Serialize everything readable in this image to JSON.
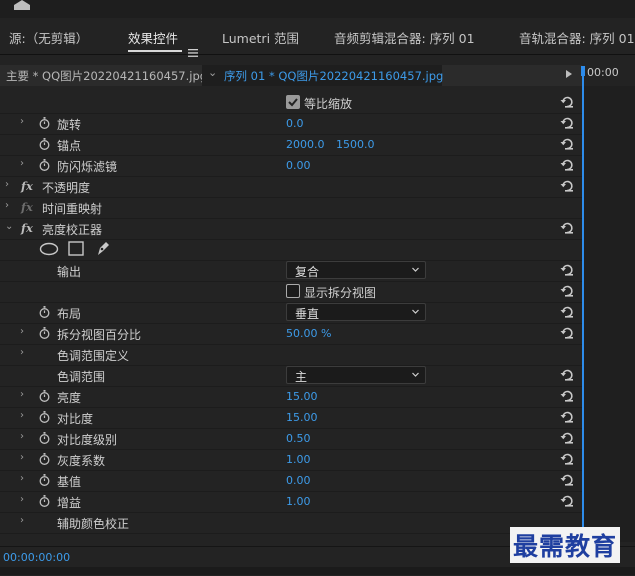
{
  "tabs": [
    {
      "label": "源:（无剪辑）"
    },
    {
      "label": "效果控件"
    },
    {
      "label": "Lumetri 范围"
    },
    {
      "label": "音频剪辑混合器: 序列 01"
    },
    {
      "label": "音轨混合器: 序列 01"
    }
  ],
  "sequence_bar": {
    "master_clip": "主要 * QQ图片20220421160457.jpg",
    "sequence_clip": "序列 01 * QQ图片20220421160457.jpg",
    "timecode": "00:00"
  },
  "properties": {
    "uniform_scale": "等比缩放",
    "rotation": {
      "label": "旋转",
      "value": "0.0"
    },
    "anchor": {
      "label": "锚点",
      "x": "2000.0",
      "y": "1500.0"
    },
    "anti_flicker": {
      "label": "防闪烁滤镜",
      "value": "0.00"
    },
    "opacity": {
      "label": "不透明度"
    },
    "time_remap": {
      "label": "时间重映射"
    },
    "brightness_corrector": {
      "label": "亮度校正器"
    },
    "output": {
      "label": "输出",
      "value": "复合"
    },
    "split_view": "显示拆分视图",
    "layout": {
      "label": "布局",
      "value": "垂直"
    },
    "split_percent": {
      "label": "拆分视图百分比",
      "value": "50.00 %"
    },
    "tonal_range_def": {
      "label": "色调范围定义"
    },
    "tonal_range": {
      "label": "色调范围",
      "value": "主"
    },
    "brightness": {
      "label": "亮度",
      "value": "15.00"
    },
    "contrast": {
      "label": "对比度",
      "value": "15.00"
    },
    "contrast_level": {
      "label": "对比度级别",
      "value": "0.50"
    },
    "gamma": {
      "label": "灰度系数",
      "value": "1.00"
    },
    "pedestal": {
      "label": "基值",
      "value": "0.00"
    },
    "gain": {
      "label": "增益",
      "value": "1.00"
    },
    "secondary_color": {
      "label": "辅助颜色校正"
    }
  },
  "bottom_timecode": "00:00:00:00",
  "watermark": "最需教育",
  "colors": {
    "accent": "#3d9be9",
    "panel": "#232323"
  }
}
